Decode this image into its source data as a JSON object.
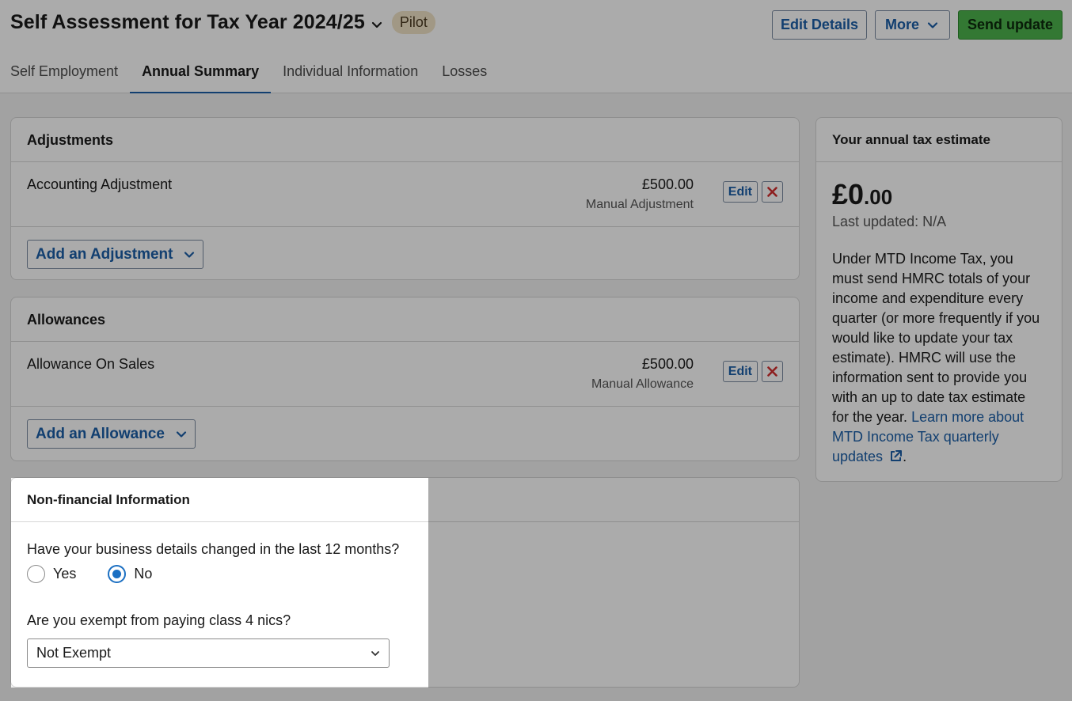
{
  "header": {
    "title": "Self Assessment for Tax Year 2024/25",
    "badge": "Pilot",
    "edit_details": "Edit Details",
    "more": "More",
    "send_update": "Send update"
  },
  "tabs": [
    {
      "label": "Self Employment"
    },
    {
      "label": "Annual Summary",
      "active": true
    },
    {
      "label": "Individual Information"
    },
    {
      "label": "Losses"
    }
  ],
  "adjustments": {
    "title": "Adjustments",
    "item": {
      "label": "Accounting Adjustment",
      "amount": "£500.00",
      "type": "Manual Adjustment"
    },
    "edit": "Edit",
    "add_button": "Add an Adjustment"
  },
  "allowances": {
    "title": "Allowances",
    "item": {
      "label": "Allowance On Sales",
      "amount": "£500.00",
      "type": "Manual Allowance"
    },
    "edit": "Edit",
    "add_button": "Add an Allowance"
  },
  "non_financial": {
    "title": "Non-financial Information",
    "q1": "Have your business details changed in the last 12 months?",
    "yes": "Yes",
    "no": "No",
    "selected": "No",
    "q2": "Are you exempt from paying class 4 nics?",
    "select_value": "Not Exempt"
  },
  "estimate": {
    "title": "Your annual tax estimate",
    "amount_main": "£0",
    "amount_pence": ".00",
    "last_updated": "Last updated: N/A",
    "body": "Under MTD Income Tax, you must send HMRC totals of your income and expenditure every quarter (or more frequently if you would like to update your tax estimate). HMRC will use the information sent to provide you with an up to date tax estimate for the year.",
    "link": "Learn more about MTD Income Tax quarterly updates",
    "after_link": "."
  },
  "colors": {
    "accent": "#1b5fa8",
    "primary_button": "#4cb34c",
    "delete": "#d32f2f",
    "overlay": "rgba(0,0,0,0.33)"
  }
}
